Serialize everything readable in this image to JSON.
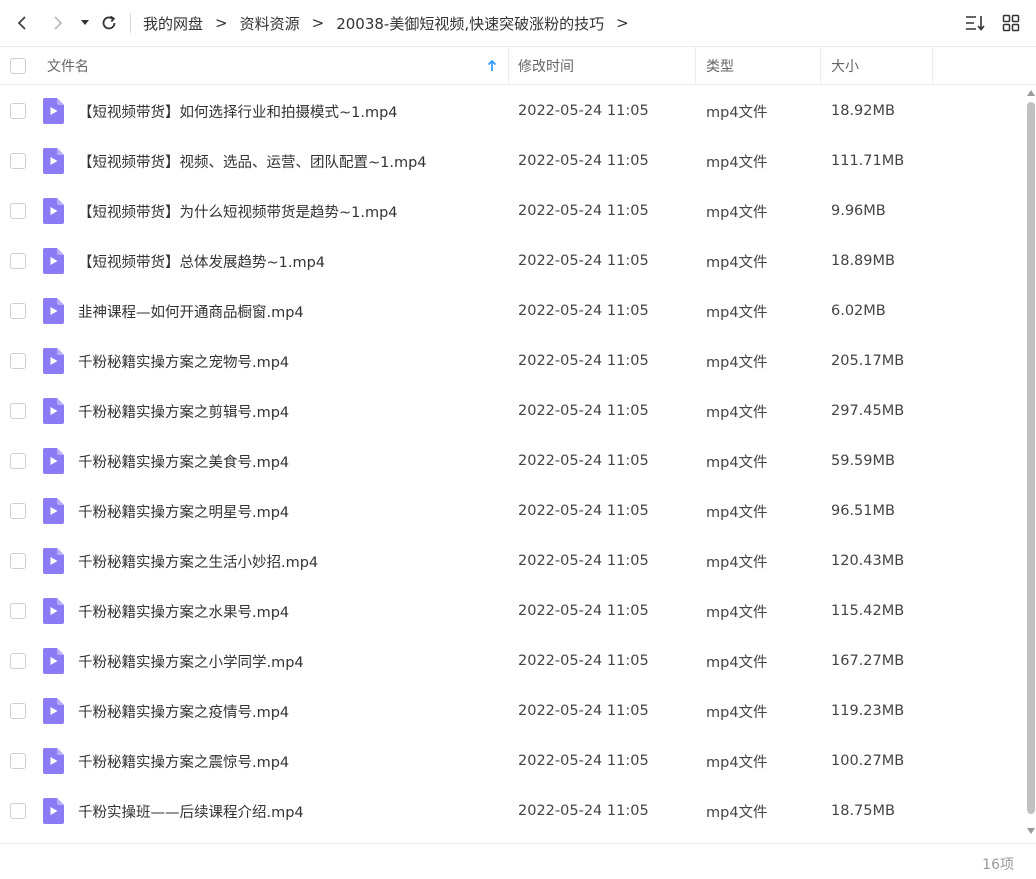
{
  "breadcrumb": [
    "我的网盘",
    "资料资源",
    "20038-美御短视频,快速突破涨粉的技巧"
  ],
  "breadcrumb_sep": ">",
  "columns": {
    "name": "文件名",
    "time": "修改时间",
    "type": "类型",
    "size": "大小"
  },
  "files": [
    {
      "name": "【短视频带货】如何选择行业和拍摄模式~1.mp4",
      "time": "2022-05-24 11:05",
      "type": "mp4文件",
      "size": "18.92MB"
    },
    {
      "name": "【短视频带货】视频、选品、运营、团队配置~1.mp4",
      "time": "2022-05-24 11:05",
      "type": "mp4文件",
      "size": "111.71MB"
    },
    {
      "name": "【短视频带货】为什么短视频带货是趋势~1.mp4",
      "time": "2022-05-24 11:05",
      "type": "mp4文件",
      "size": "9.96MB"
    },
    {
      "name": "【短视频带货】总体发展趋势~1.mp4",
      "time": "2022-05-24 11:05",
      "type": "mp4文件",
      "size": "18.89MB"
    },
    {
      "name": "韭神课程—如何开通商品橱窗.mp4",
      "time": "2022-05-24 11:05",
      "type": "mp4文件",
      "size": "6.02MB"
    },
    {
      "name": "千粉秘籍实操方案之宠物号.mp4",
      "time": "2022-05-24 11:05",
      "type": "mp4文件",
      "size": "205.17MB"
    },
    {
      "name": "千粉秘籍实操方案之剪辑号.mp4",
      "time": "2022-05-24 11:05",
      "type": "mp4文件",
      "size": "297.45MB"
    },
    {
      "name": "千粉秘籍实操方案之美食号.mp4",
      "time": "2022-05-24 11:05",
      "type": "mp4文件",
      "size": "59.59MB"
    },
    {
      "name": "千粉秘籍实操方案之明星号.mp4",
      "time": "2022-05-24 11:05",
      "type": "mp4文件",
      "size": "96.51MB"
    },
    {
      "name": "千粉秘籍实操方案之生活小妙招.mp4",
      "time": "2022-05-24 11:05",
      "type": "mp4文件",
      "size": "120.43MB"
    },
    {
      "name": "千粉秘籍实操方案之水果号.mp4",
      "time": "2022-05-24 11:05",
      "type": "mp4文件",
      "size": "115.42MB"
    },
    {
      "name": "千粉秘籍实操方案之小学同学.mp4",
      "time": "2022-05-24 11:05",
      "type": "mp4文件",
      "size": "167.27MB"
    },
    {
      "name": "千粉秘籍实操方案之疫情号.mp4",
      "time": "2022-05-24 11:05",
      "type": "mp4文件",
      "size": "119.23MB"
    },
    {
      "name": "千粉秘籍实操方案之震惊号.mp4",
      "time": "2022-05-24 11:05",
      "type": "mp4文件",
      "size": "100.27MB"
    },
    {
      "name": "千粉实操班——后续课程介绍.mp4",
      "time": "2022-05-24 11:05",
      "type": "mp4文件",
      "size": "18.75MB"
    }
  ],
  "footer": {
    "count": "16项"
  },
  "icons": {
    "back": "chevron-left-icon",
    "forward": "chevron-right-icon",
    "dropdown": "caret-down-icon",
    "refresh": "refresh-icon",
    "sort": "sort-list-icon",
    "grid": "grid-view-icon",
    "file": "video-file-icon",
    "sort_asc": "arrow-up-icon"
  },
  "colors": {
    "file_icon": "#8b7cf6",
    "sort_arrow": "#3b9df8"
  }
}
